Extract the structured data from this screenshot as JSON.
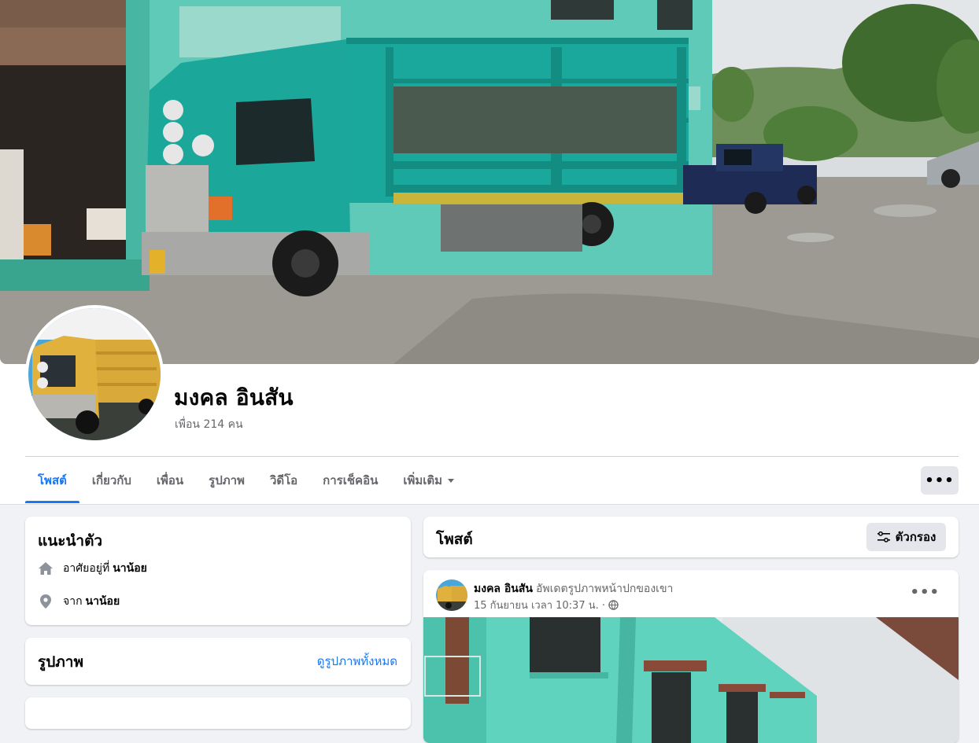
{
  "profile": {
    "name": "มงคล อินสัน",
    "friends": "เพื่อน 214 คน"
  },
  "tabs": [
    {
      "label": "โพสต์",
      "active": true
    },
    {
      "label": "เกี่ยวกับ"
    },
    {
      "label": "เพื่อน"
    },
    {
      "label": "รูปภาพ"
    },
    {
      "label": "วิดีโอ"
    },
    {
      "label": "การเช็คอิน"
    },
    {
      "label": "เพิ่มเติม",
      "has_caret": true
    }
  ],
  "more_button": "•••",
  "intro": {
    "title": "แนะนำตัว",
    "lives_prefix": "อาศัยอยู่ที่",
    "lives_place": "นาน้อย",
    "from_prefix": "จาก",
    "from_place": "นาน้อย"
  },
  "photos": {
    "title": "รูปภาพ",
    "see_all": "ดูรูปภาพทั้งหมด"
  },
  "posts": {
    "title": "โพสต์",
    "filter_label": "ตัวกรอง"
  },
  "post": {
    "author": "มงคล อินสัน",
    "action": "อัพเดตรูปภาพหน้าปกของเขา",
    "date": "15 กันยายน เวลา 10:37 น. ·",
    "menu": "•••"
  },
  "colors": {
    "accent": "#1877f2",
    "secondary_text": "#65676b",
    "page_bg": "#f0f2f5",
    "truck_teal": "#1aa89c"
  },
  "icons": {
    "home": "home-icon",
    "location": "location-pin-icon",
    "filter": "filter-sliders-icon",
    "globe": "globe-icon"
  }
}
